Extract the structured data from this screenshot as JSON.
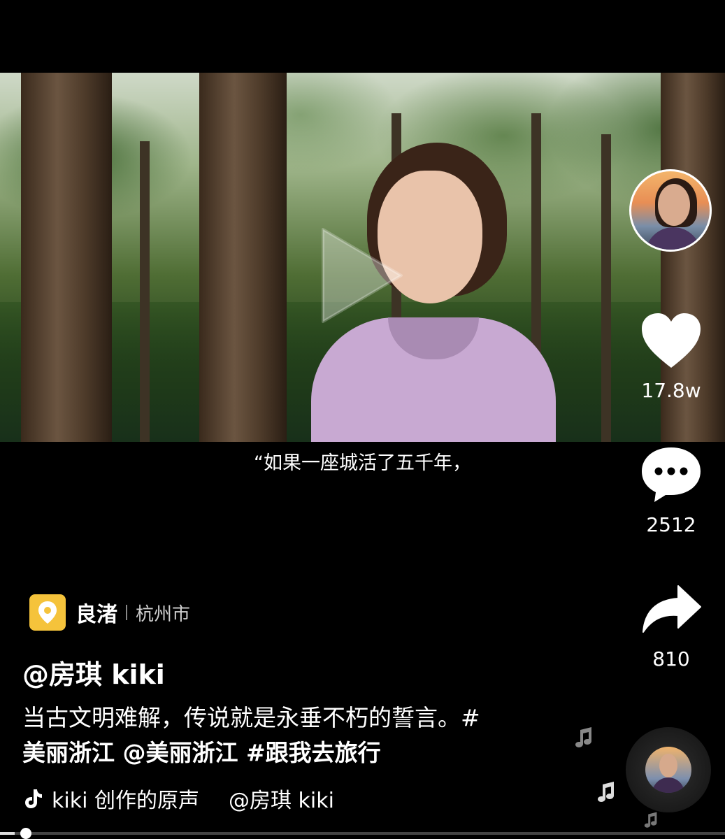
{
  "video": {
    "subtitle": "“如果一座城活了五千年，",
    "progress": 0.02
  },
  "rail": {
    "like_count": "17.8w",
    "comment_count": "2512",
    "share_count": "810"
  },
  "poi": {
    "name": "良渚",
    "city": "杭州市"
  },
  "post": {
    "author": "@房琪 kiki",
    "description_line1": "当古文明难解，传说就是永垂不朽的誓言。#",
    "description_tags": "美丽浙江 @美丽浙江 #跟我去旅行"
  },
  "music": {
    "title": "kiki 创作的原声",
    "author": "@房琪 kiki"
  },
  "colors": {
    "background": "#000000",
    "poi_icon": "#f5c33b",
    "text": "#ffffff",
    "hoodie": "#c8a9d2"
  },
  "icons": [
    "play-icon",
    "heart-icon",
    "comment-icon",
    "share-icon",
    "location-pin-icon",
    "tiktok-note-icon",
    "music-note-icon"
  ]
}
